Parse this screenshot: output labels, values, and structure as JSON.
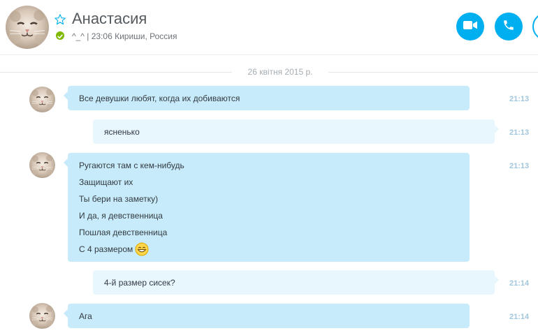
{
  "header": {
    "contact_name": "Анастасия",
    "status_text": "^_^ | 23:06 Кириши, Россия",
    "icons": {
      "favorite": "star-outline-icon",
      "presence": "online-check-icon",
      "video": "video-camera-icon",
      "call": "phone-icon",
      "add": "add-participant-icon"
    },
    "colors": {
      "accent": "#00aff0",
      "presence": "#7fba00"
    }
  },
  "conversation": {
    "date_divider": "26 квітня 2015 р.",
    "messages": [
      {
        "direction": "incoming",
        "lines": [
          "Все девушки любят, когда их добиваются"
        ],
        "time": "21:13"
      },
      {
        "direction": "outgoing",
        "lines": [
          "ясненько"
        ],
        "time": "21:13"
      },
      {
        "direction": "incoming",
        "lines": [
          "Ругаются там с кем-нибудь",
          "Защищают их",
          "Ты бери на заметку)",
          "И да, я девственница",
          "Пошлая девственница",
          "С 4 размером"
        ],
        "emoji": "grinning-emoji-icon",
        "time": "21:13"
      },
      {
        "direction": "outgoing",
        "lines": [
          "4-й размер сисек?"
        ],
        "time": "21:14"
      },
      {
        "direction": "incoming",
        "lines": [
          "Ага"
        ],
        "time": "21:14"
      }
    ],
    "colors": {
      "incoming_bubble": "#c7ebfa",
      "outgoing_bubble": "#e8f6fd",
      "timestamp": "#a2c6dc"
    }
  }
}
